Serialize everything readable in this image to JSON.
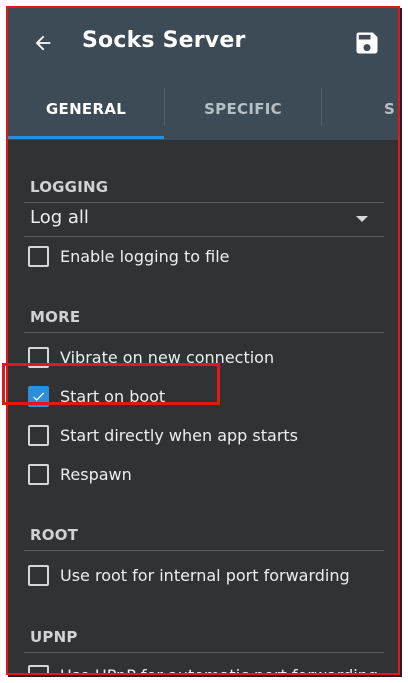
{
  "header": {
    "title": "Socks Server",
    "back_icon": "arrow-left-icon",
    "save_icon": "floppy-disk-icon"
  },
  "tabs": [
    {
      "label": "GENERAL",
      "active": true
    },
    {
      "label": "SPECIFIC",
      "active": false
    },
    {
      "label": "S",
      "active": false
    }
  ],
  "sections": {
    "logging": {
      "title": "LOGGING",
      "dropdown_value": "Log all",
      "options": [
        {
          "label": "Enable logging to file",
          "checked": false
        }
      ]
    },
    "more": {
      "title": "MORE",
      "options": [
        {
          "label": "Vibrate on new connection",
          "checked": false
        },
        {
          "label": "Start on boot",
          "checked": true
        },
        {
          "label": "Start directly when app starts",
          "checked": false
        },
        {
          "label": "Respawn",
          "checked": false
        }
      ]
    },
    "root": {
      "title": "ROOT",
      "options": [
        {
          "label": "Use root for internal port forwarding",
          "checked": false
        }
      ]
    },
    "upnp": {
      "title": "UPNP",
      "options": [
        {
          "label": "Use UPnP for automatic port forwarding",
          "checked": false
        }
      ]
    }
  },
  "colors": {
    "accent": "#2e8fd8",
    "toolbar": "#3c4b55",
    "background": "#303233",
    "highlight": "#e01818"
  }
}
